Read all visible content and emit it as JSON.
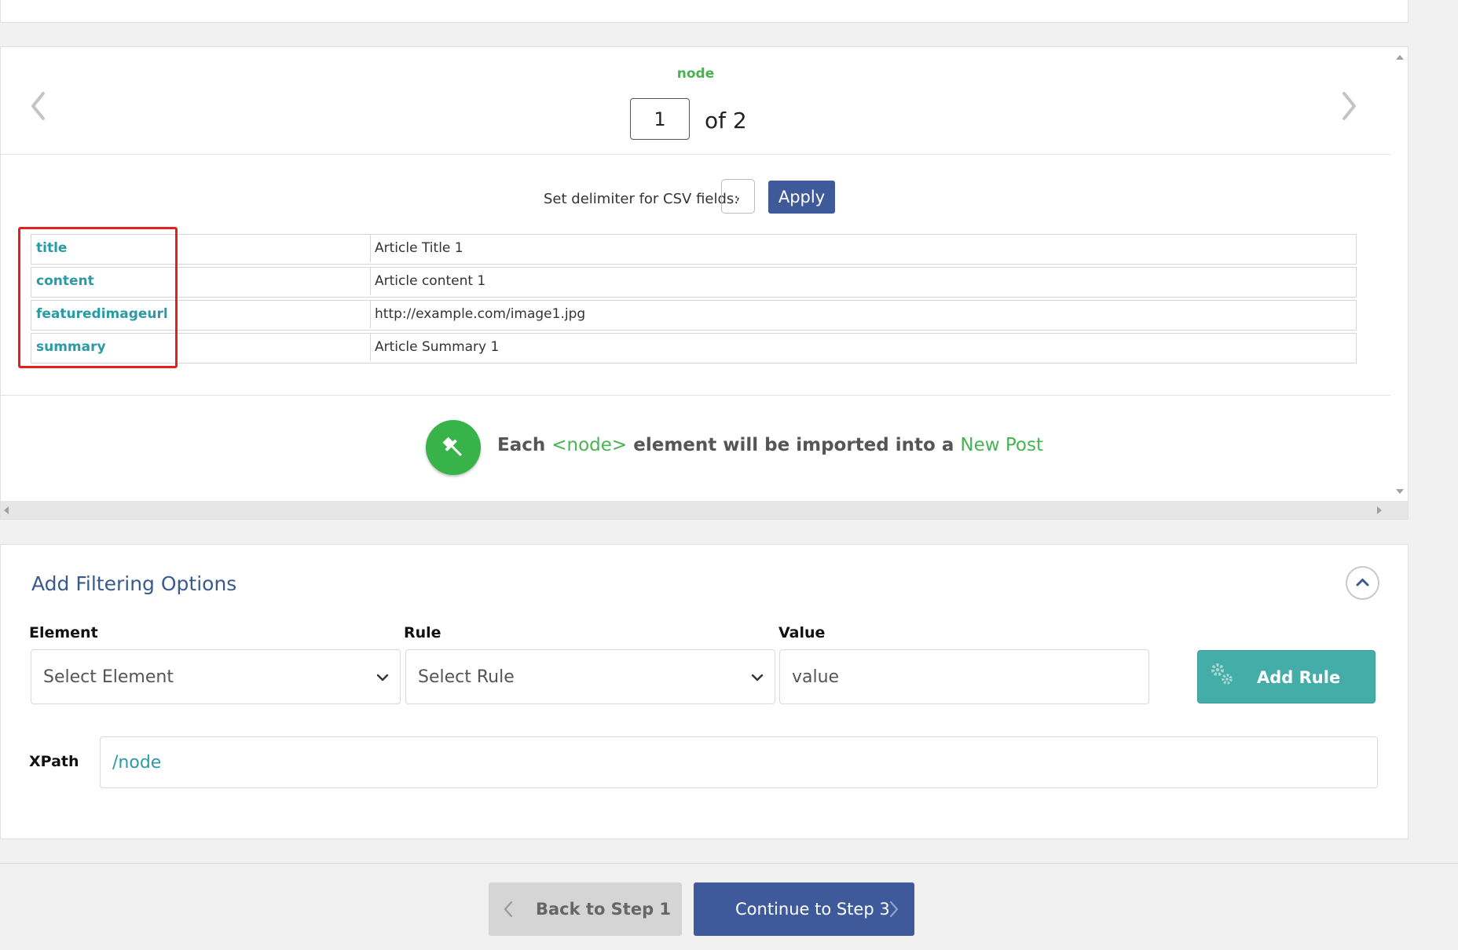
{
  "preview": {
    "node_label": "node",
    "current_page": "1",
    "of_total": "of 2",
    "delimiter_label": "Set delimiter for CSV fields:",
    "delimiter_value": ",",
    "apply_label": "Apply",
    "fields": [
      {
        "name": "title",
        "value": "Article Title 1"
      },
      {
        "name": "content",
        "value": "Article content 1"
      },
      {
        "name": "featuredimageurl",
        "value": "http://example.com/image1.jpg"
      },
      {
        "name": "summary",
        "value": "Article Summary 1"
      }
    ],
    "import_message": {
      "prefix": "Each",
      "node_tag": "<node>",
      "middle": "element will be imported into a",
      "post_type": "New Post"
    }
  },
  "filter": {
    "title": "Add Filtering Options",
    "element_label": "Element",
    "element_placeholder": "Select Element",
    "rule_label": "Rule",
    "rule_placeholder": "Select Rule",
    "value_label": "Value",
    "value_placeholder": "value",
    "add_rule_label": "Add Rule",
    "xpath_label": "XPath",
    "xpath_value": "/node"
  },
  "footer": {
    "back_label": "Back to Step 1",
    "continue_label": "Continue to Step 3"
  },
  "colors": {
    "accent_green": "#46b450",
    "primary_blue": "#3e5a9a",
    "teal": "#45ada8",
    "highlight_red": "#e31f1f"
  }
}
